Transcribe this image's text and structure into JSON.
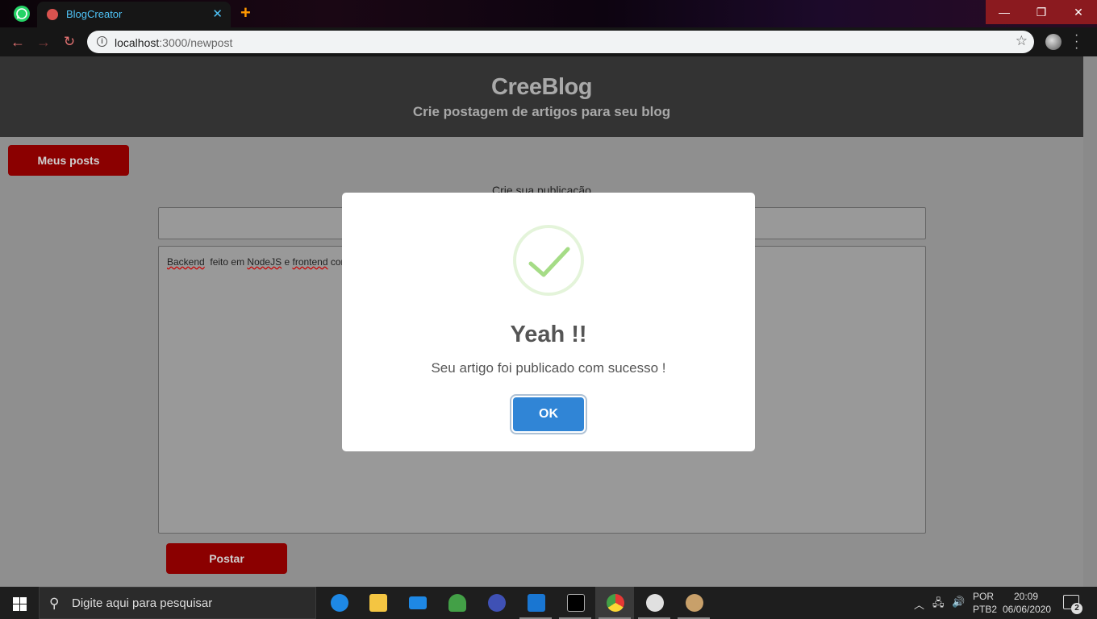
{
  "browser": {
    "tab_title": "BlogCreator",
    "tab_close": "✕",
    "new_tab": "+",
    "url_host": "localhost",
    "url_path": ":3000/newpost",
    "win_min": "—",
    "win_max": "❐",
    "win_close": "✕"
  },
  "header": {
    "title": "CreeBlog",
    "subtitle": "Crie postagem de artigos para seu blog"
  },
  "page": {
    "my_posts_button": "Meus posts",
    "form_label": "Crie sua publicação",
    "title_input_value": "",
    "content_words": [
      "Backend",
      "feito em",
      "NodeJS",
      "e",
      "frontend",
      "com"
    ],
    "post_button": "Postar"
  },
  "modal": {
    "title": "Yeah !!",
    "message": "Seu artigo foi publicado com sucesso !",
    "ok_button": "OK",
    "success_color": "#a5dc86",
    "button_color": "#3085d6"
  },
  "taskbar": {
    "search_placeholder": "Digite aqui para pesquisar",
    "language": "POR",
    "layout": "PTB2",
    "time": "20:09",
    "date": "06/06/2020",
    "notifications": "2"
  },
  "colors": {
    "header_bg": "#333333",
    "accent_red": "#8b0000"
  }
}
